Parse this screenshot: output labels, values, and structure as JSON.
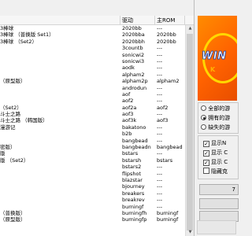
{
  "list": {
    "columns": {
      "name": "",
      "driver": "驱动",
      "rom": "主ROM"
    },
    "rows": [
      {
        "name": "3棒球",
        "driver": "2020bb",
        "rom": "---"
      },
      {
        "name": "3棒球 （普换版 Set1）",
        "driver": "2020bba",
        "rom": "2020bb"
      },
      {
        "name": "3棒球 （Set2）",
        "driver": "2020bbh",
        "rom": "2020bb"
      },
      {
        "name": "",
        "driver": "3countb",
        "rom": "---"
      },
      {
        "name": "",
        "driver": "sonicwi2",
        "rom": "---"
      },
      {
        "name": "",
        "driver": "sonicwi3",
        "rom": "---"
      },
      {
        "name": "",
        "driver": "aodk",
        "rom": "---"
      },
      {
        "name": "",
        "driver": "alpham2",
        "rom": "---"
      },
      {
        "name": "（原型版）",
        "driver": "alpham2p",
        "rom": "alpham2"
      },
      {
        "name": "",
        "driver": "androdun",
        "rom": "---"
      },
      {
        "name": "",
        "driver": "aof",
        "rom": "---"
      },
      {
        "name": "",
        "driver": "aof2",
        "rom": "---"
      },
      {
        "name": "（Set2）",
        "driver": "aof2a",
        "rom": "aof2"
      },
      {
        "name": "斗士之路",
        "driver": "aof3",
        "rom": "---"
      },
      {
        "name": "斗士之路 （韩国版）",
        "driver": "aof3k",
        "rom": "aof3"
      },
      {
        "name": "漫游记",
        "driver": "bakatono",
        "rom": "---"
      },
      {
        "name": "",
        "driver": "b2b",
        "rom": "---"
      },
      {
        "name": "",
        "driver": "bangbead",
        "rom": "---"
      },
      {
        "name": "密版）",
        "driver": "bangbeadn",
        "rom": "bangbead"
      },
      {
        "name": "版",
        "driver": "bstars",
        "rom": "---"
      },
      {
        "name": "版 （Set2）",
        "driver": "bstarsh",
        "rom": "bstars"
      },
      {
        "name": "",
        "driver": "bstars2",
        "rom": "---"
      },
      {
        "name": "",
        "driver": "flipshot",
        "rom": "---"
      },
      {
        "name": "",
        "driver": "blazstar",
        "rom": "---"
      },
      {
        "name": "",
        "driver": "bjourney",
        "rom": "---"
      },
      {
        "name": "",
        "driver": "breakers",
        "rom": "---"
      },
      {
        "name": "",
        "driver": "breakrev",
        "rom": "---"
      },
      {
        "name": "",
        "driver": "burningf",
        "rom": "---"
      },
      {
        "name": "（普换版）",
        "driver": "burningfh",
        "rom": "burningf"
      },
      {
        "name": "（原型版）",
        "driver": "burningfp",
        "rom": "burningf"
      }
    ]
  },
  "panel": {
    "logo_text": "WIN",
    "logo_sub": "K",
    "radios": [
      {
        "label": "全部的游",
        "selected": false
      },
      {
        "label": "拥有的游",
        "selected": true
      },
      {
        "label": "缺失的游",
        "selected": false
      }
    ],
    "checkboxes": [
      {
        "label": "显示N",
        "checked": true
      },
      {
        "label": "显示 C",
        "checked": true
      },
      {
        "label": "显示 C",
        "checked": true
      },
      {
        "label": "隐藏克",
        "checked": false
      }
    ],
    "buttons": [
      "7",
      "",
      ""
    ]
  },
  "colors": {
    "logo_orange": "#ff6a00",
    "logo_ring": "#ffd700",
    "logo_text": "#ffffff"
  }
}
